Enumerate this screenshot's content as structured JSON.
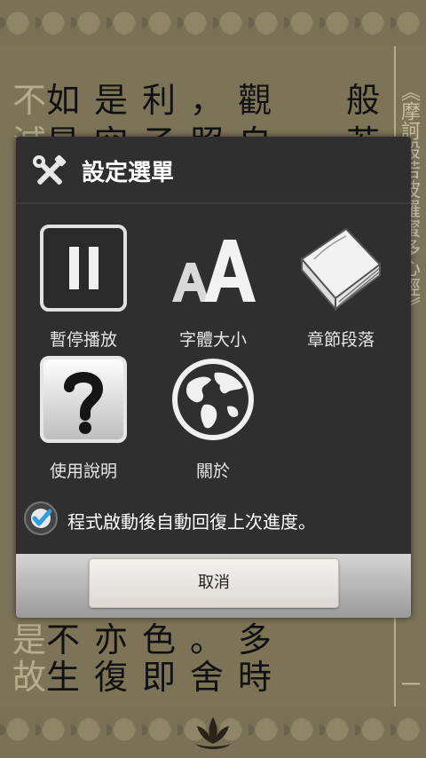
{
  "background": {
    "lines": [
      {
        "dim": "不",
        "main": "如是利，觀"
      },
      {
        "dim": "減",
        "main": "是空子照自"
      },
      {
        "dim": "是",
        "main": "不亦色。多"
      },
      {
        "dim": "故",
        "main": "生復即舍時"
      }
    ],
    "right_top": "般",
    "right_second": "若",
    "side_title": "《摩訶般若波羅蜜多心經》",
    "side_bottom": "一"
  },
  "dialog": {
    "title": "設定選單",
    "items": [
      {
        "label": "暫停播放",
        "icon": "pause-icon"
      },
      {
        "label": "字體大小",
        "icon": "font-size-icon"
      },
      {
        "label": "章節段落",
        "icon": "book-icon"
      },
      {
        "label": "使用說明",
        "icon": "help-icon"
      },
      {
        "label": "關於",
        "icon": "globe-icon"
      }
    ],
    "resume_checkbox": {
      "label": "程式啟動後自動回復上次進度。",
      "checked": true
    },
    "cancel_label": "取消"
  },
  "colors": {
    "dialog_bg": "#2f2f2f",
    "page_bg": "#7d7458",
    "check_accent": "#2f9de0"
  }
}
